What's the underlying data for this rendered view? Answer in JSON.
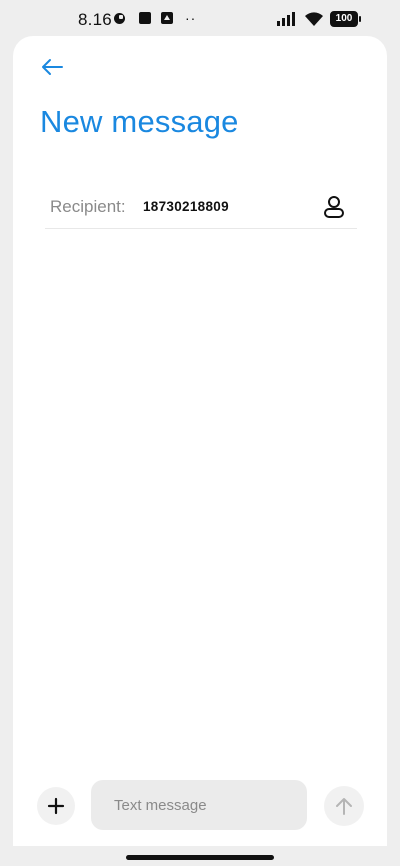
{
  "status_bar": {
    "time": "8.16",
    "dots": "··",
    "battery": "100"
  },
  "header": {
    "title": "New message"
  },
  "recipient": {
    "label": "Recipient:",
    "value": "18730218809"
  },
  "composer": {
    "placeholder": "Text message",
    "value": ""
  },
  "colors": {
    "accent": "#1a88e0",
    "background": "#eeeeee",
    "card": "#ffffff"
  },
  "icons": {
    "back": "arrow-left-icon",
    "contact": "person-icon",
    "add": "plus-icon",
    "send": "arrow-up-icon"
  }
}
